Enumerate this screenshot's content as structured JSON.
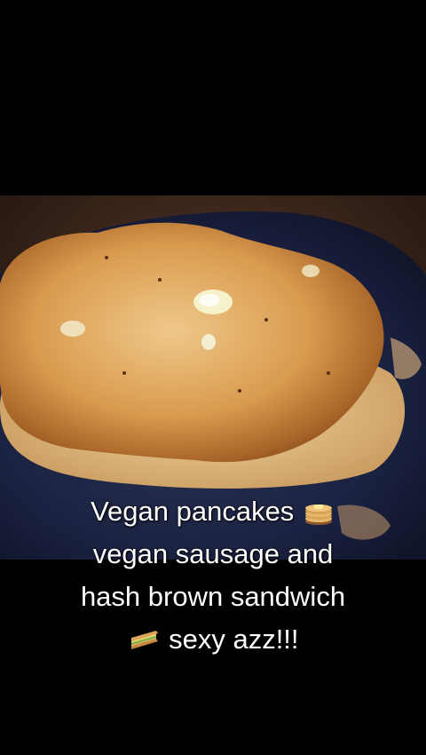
{
  "caption": {
    "line1_text": "Vegan pancakes",
    "line1_icon": "pancakes-emoji-icon",
    "line2_text": "vegan sausage and",
    "line3_text": "hash brown sandwich",
    "line4_icon": "sandwich-emoji-icon",
    "line4_text": "sexy azz!!!"
  },
  "video": {
    "subject": "pancake-on-plate-photo"
  },
  "colors": {
    "background": "#000000",
    "caption_text": "#ffffff",
    "plate": "#1c2340",
    "pancake": "#d9a35a",
    "butter": "#f4f0c8"
  }
}
